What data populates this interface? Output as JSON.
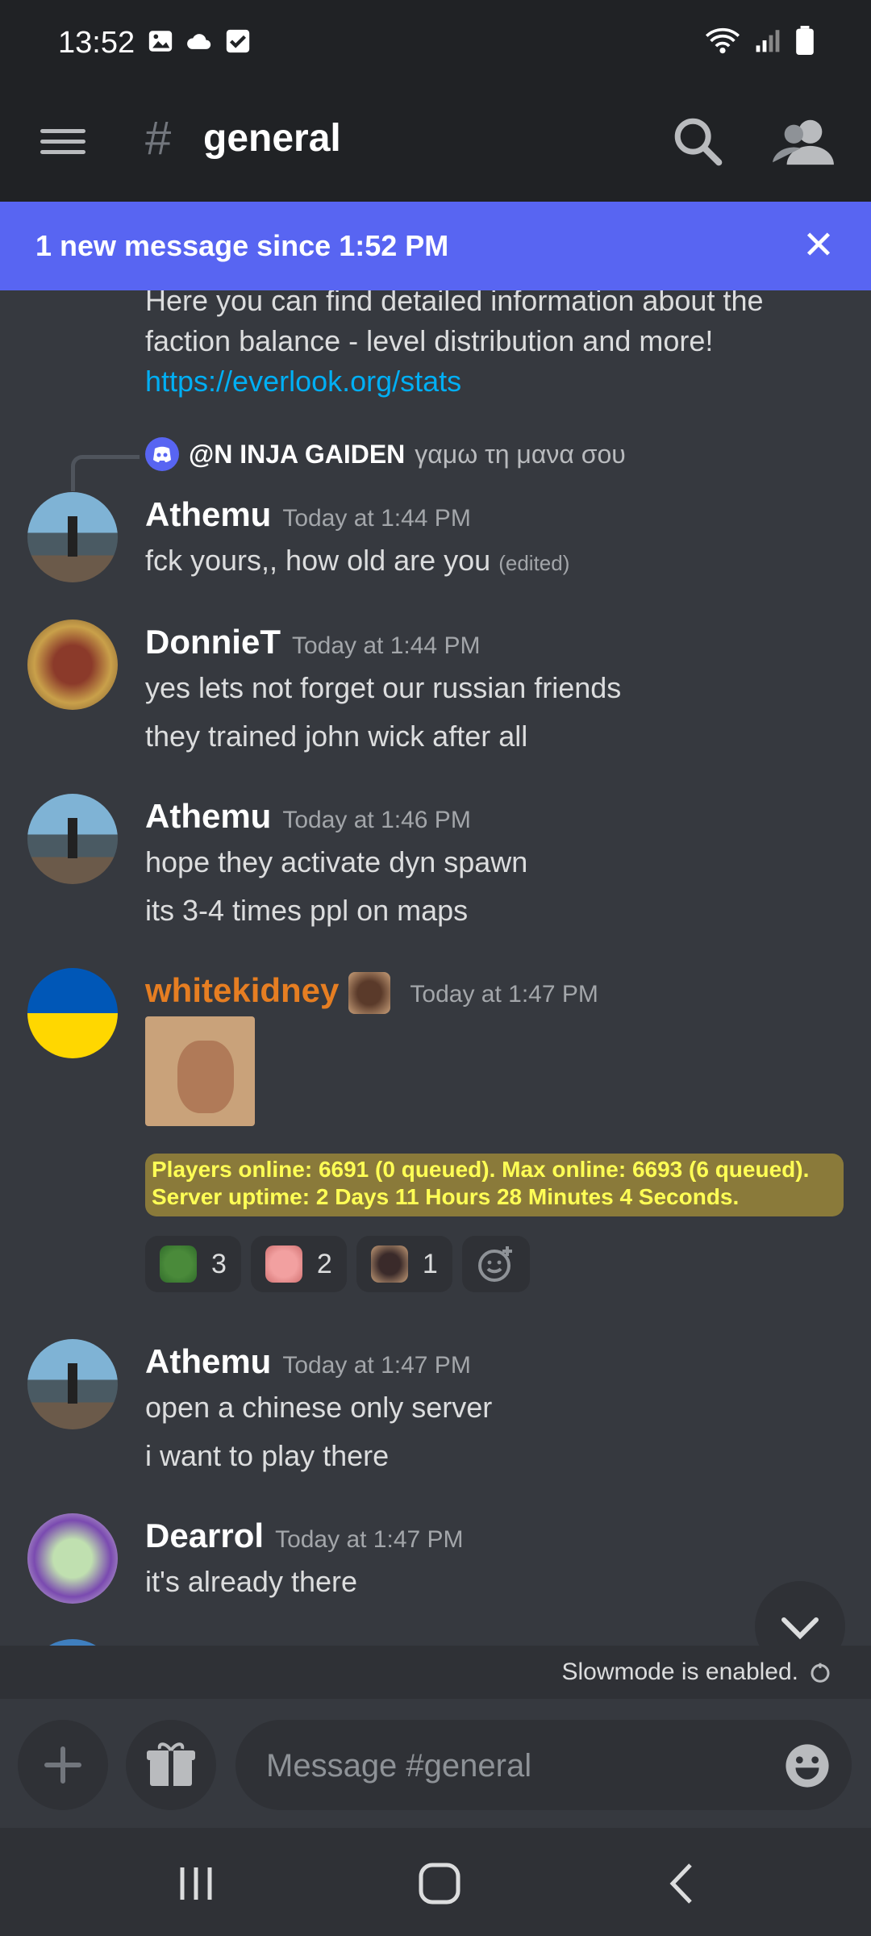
{
  "status_bar": {
    "time": "13:52",
    "left_icons": [
      "gallery-icon",
      "cloud-icon",
      "checkbox-icon"
    ],
    "right_icons": [
      "wifi-icon",
      "signal-icon",
      "battery-icon"
    ]
  },
  "header": {
    "hash": "#",
    "channel": "general"
  },
  "new_message_bar": {
    "text": "1 new message since 1:52 PM",
    "close": "✕"
  },
  "system_message": {
    "line1": "Here you can find detailed information about the",
    "line2": "faction balance - level distribution and more!",
    "link": "https://everlook.org/stats"
  },
  "messages": [
    {
      "reply": {
        "mention": "@N INJA GAIDEN",
        "text": "γαμω τη μανα σου"
      },
      "author": "Athemu",
      "time": "Today at 1:44 PM",
      "lines": [
        "fck yours,, how old are you"
      ],
      "edited": "(edited)"
    },
    {
      "author": "DonnieT",
      "time": "Today at 1:44 PM",
      "lines": [
        "yes lets not forget our russian friends",
        "they trained john wick after all"
      ]
    },
    {
      "author": "Athemu",
      "time": "Today at 1:46 PM",
      "lines": [
        "hope they activate dyn spawn",
        "its  3-4 times ppl on maps"
      ]
    },
    {
      "author": "whitekidney",
      "author_color": "#e67e22",
      "time": "Today at 1:47 PM",
      "banner": {
        "line1": "Players online: 6691 (0 queued). Max online: 6693 (6 queued).",
        "line2": "Server uptime: 2 Days 11 Hours 28 Minutes 4 Seconds."
      },
      "reactions": [
        {
          "icon": "pepe-emoji",
          "count": "3"
        },
        {
          "icon": "pig-emoji",
          "count": "2"
        },
        {
          "icon": "dog-emoji",
          "count": "1"
        }
      ]
    },
    {
      "author": "Athemu",
      "time": "Today at 1:47 PM",
      "lines": [
        "open a  chinese only server",
        "i want to play there"
      ]
    },
    {
      "author": "Dearrol",
      "time": "Today at 1:47 PM",
      "lines": [
        "it's already there"
      ]
    }
  ],
  "slowmode": "Slowmode is enabled.",
  "composer": {
    "placeholder": "Message #general"
  },
  "colors": {
    "accent": "#5865f2",
    "background": "#36393f",
    "link": "#00aff4"
  }
}
